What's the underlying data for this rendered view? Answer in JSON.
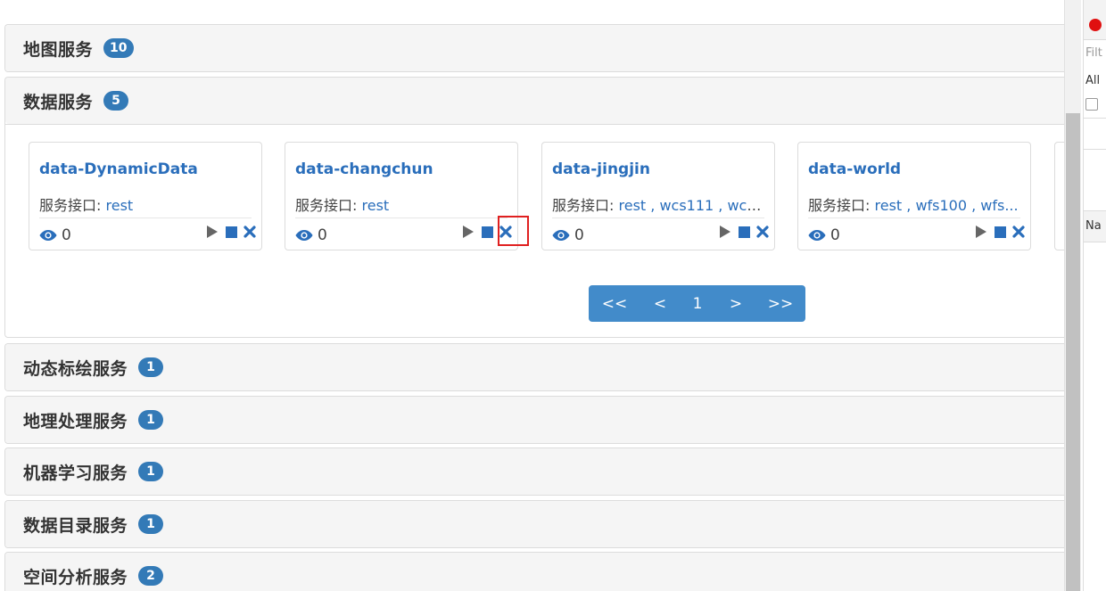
{
  "sections": [
    {
      "title": "地图服务",
      "count": "10"
    },
    {
      "title": "数据服务",
      "count": "5"
    },
    {
      "title": "动态标绘服务",
      "count": "1"
    },
    {
      "title": "地理处理服务",
      "count": "1"
    },
    {
      "title": "机器学习服务",
      "count": "1"
    },
    {
      "title": "数据目录服务",
      "count": "1"
    },
    {
      "title": "空间分析服务",
      "count": "2"
    }
  ],
  "cards": [
    {
      "title": "data-DynamicData",
      "iface_label": "服务接口:",
      "iface_value": "rest",
      "views": "0"
    },
    {
      "title": "data-changchun",
      "iface_label": "服务接口:",
      "iface_value": "rest",
      "views": "0"
    },
    {
      "title": "data-jingjin",
      "iface_label": "服务接口:",
      "iface_value": "rest , wcs111 , wcs...",
      "views": "0"
    },
    {
      "title": "data-world",
      "iface_label": "服务接口:",
      "iface_value": "rest , wfs100 , wfs...",
      "views": "0"
    }
  ],
  "pager": {
    "first": "<<",
    "prev": "<",
    "page": "1",
    "next": ">",
    "last": ">>"
  },
  "devtools": {
    "filter_placeholder": "Filt",
    "all_label": "All",
    "name_header": "Na"
  },
  "colors": {
    "accent": "#337ab7",
    "link": "#2a6ebb",
    "pager": "#428bca",
    "highlight": "#e02020"
  }
}
